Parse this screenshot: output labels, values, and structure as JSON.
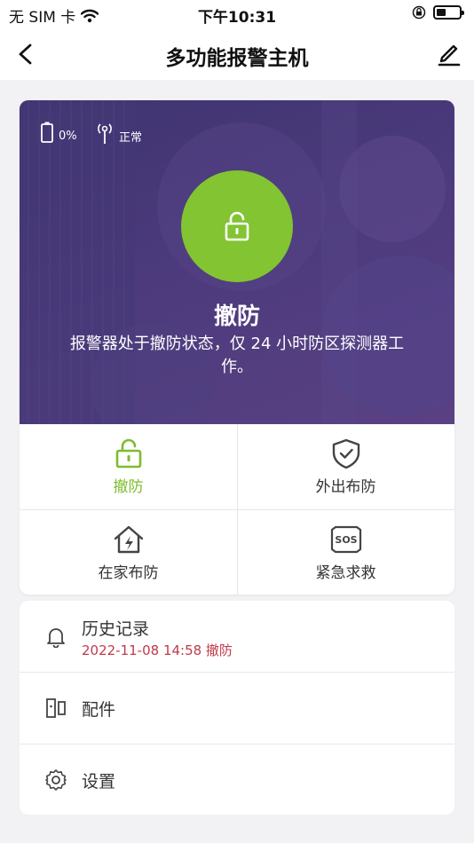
{
  "status_bar": {
    "carrier": "无 SIM 卡",
    "time": "下午10:31"
  },
  "nav": {
    "title": "多功能报警主机"
  },
  "hero": {
    "battery_text": "0%",
    "signal_text": "正常",
    "state_title": "撤防",
    "state_desc": "报警器处于撤防状态，仅 24 小时防区探测器工作。"
  },
  "modes": [
    {
      "label": "撤防",
      "icon": "unlock-icon",
      "active": true
    },
    {
      "label": "外出布防",
      "icon": "shield-check-icon",
      "active": false
    },
    {
      "label": "在家布防",
      "icon": "home-lightning-icon",
      "active": false
    },
    {
      "label": "紧急求救",
      "icon": "sos-icon",
      "active": false
    }
  ],
  "list": {
    "history": {
      "label": "历史记录",
      "sub": "2022-11-08 14:58 撤防"
    },
    "accessories": {
      "label": "配件"
    },
    "settings": {
      "label": "设置"
    }
  },
  "colors": {
    "accent_green": "#82c431",
    "hero_purple": "#4b3a7c",
    "history_red": "#c0394a"
  }
}
